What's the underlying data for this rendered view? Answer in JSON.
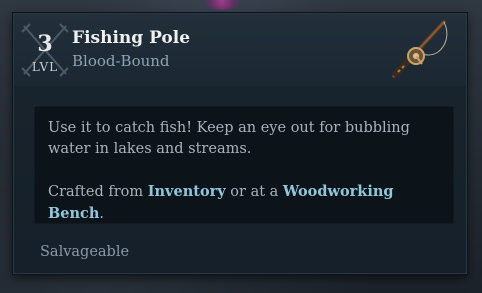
{
  "item": {
    "level": "3",
    "level_label": "LVL",
    "name": "Fishing Pole",
    "binding": "Blood-Bound",
    "icon": "fishing-pole-icon"
  },
  "description": {
    "line1": "Use it to catch fish! Keep an eye out for bubbling water in lakes and streams.",
    "crafted_prefix": "Crafted from ",
    "crafted_source1": "Inventory",
    "crafted_middle": " or at a ",
    "crafted_source2": "Woodworking Bench",
    "crafted_suffix": "."
  },
  "footer": {
    "status": "Salvageable"
  },
  "colors": {
    "panel_bg": "#17222b",
    "desc_bg": "#0d1419",
    "highlight": "#8fc6dc",
    "subtitle": "#8ba3b4"
  }
}
